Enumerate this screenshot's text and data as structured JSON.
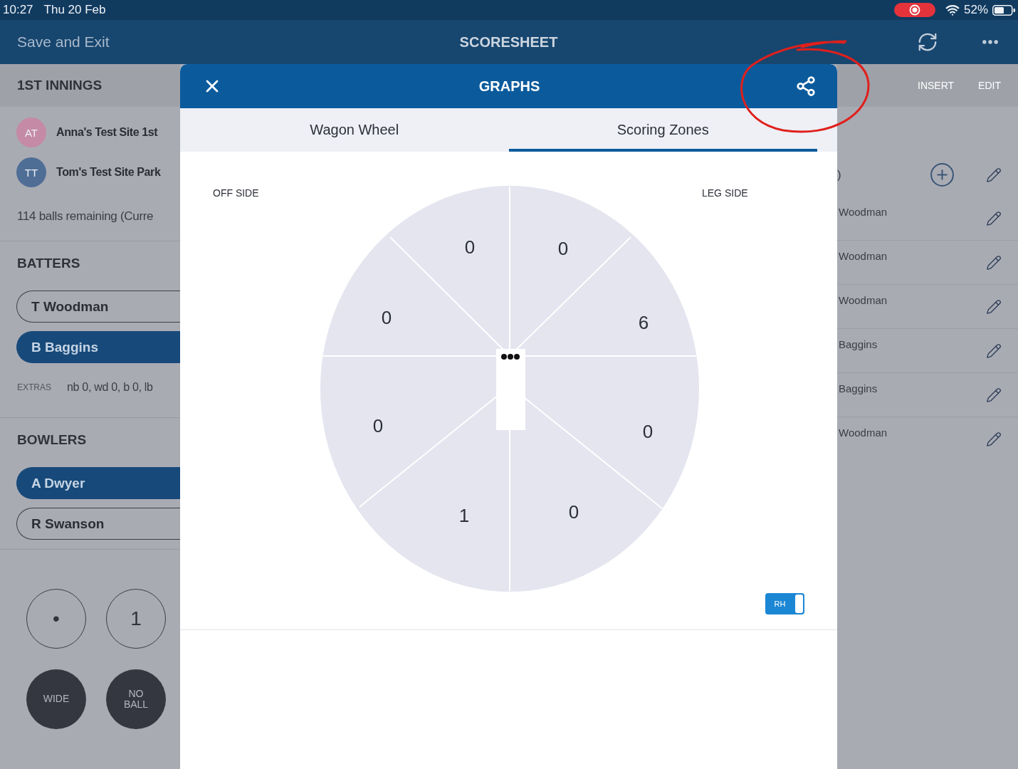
{
  "status_bar": {
    "time": "10:27",
    "date": "Thu 20 Feb",
    "battery": "52%"
  },
  "nav_bar": {
    "back": "Save and Exit",
    "title": "SCORESHEET"
  },
  "innings_header": {
    "title": "1ST INNINGS",
    "actions": [
      "INSERT",
      "EDIT"
    ]
  },
  "teams": [
    {
      "initials": "AT",
      "name": "Anna's Test Site 1st",
      "color": "#c48aa6"
    },
    {
      "initials": "TT",
      "name": "Tom's Test Site Park",
      "color": "#4f6e96"
    }
  ],
  "balls_remaining": "114 balls remaining (Curre",
  "batters": {
    "title": "BATTERS",
    "players": [
      {
        "name": "T Woodman",
        "selected": false
      },
      {
        "name": "B Baggins",
        "selected": true
      }
    ]
  },
  "extras": {
    "label": "EXTRAS",
    "value": "nb 0, wd 0, b 0, lb"
  },
  "bowlers": {
    "title": "BOWLERS",
    "players": [
      {
        "name": "A Dwyer",
        "selected": true
      },
      {
        "name": "R Swanson",
        "selected": false
      }
    ]
  },
  "scoring_buttons": [
    {
      "label": "•",
      "kind": "outline"
    },
    {
      "label": "1",
      "kind": "outline"
    },
    {
      "label": "WIDE",
      "kind": "filled"
    },
    {
      "label": "NO BALL",
      "kind": "filled"
    }
  ],
  "modal": {
    "title": "GRAPHS",
    "tabs": [
      {
        "label": "Wagon Wheel",
        "selected": false
      },
      {
        "label": "Scoring Zones",
        "selected": true
      }
    ],
    "scoring_zones": {
      "off_side_label": "OFF SIDE",
      "leg_side_label": "LEG SIDE",
      "zones": [
        {
          "runs": "0"
        },
        {
          "runs": "0"
        },
        {
          "runs": "0"
        },
        {
          "runs": "6"
        },
        {
          "runs": "0"
        },
        {
          "runs": "0"
        },
        {
          "runs": "1"
        },
        {
          "runs": "0"
        }
      ]
    },
    "batting_hand": {
      "label": "RH",
      "on": true
    }
  },
  "deliveries": {
    "fragment": ")",
    "rows": [
      {
        "batter": "Woodman"
      },
      {
        "batter": "Woodman"
      },
      {
        "batter": "Woodman"
      },
      {
        "batter": "Baggins"
      },
      {
        "batter": "Baggins"
      },
      {
        "batter": "Woodman"
      }
    ]
  }
}
